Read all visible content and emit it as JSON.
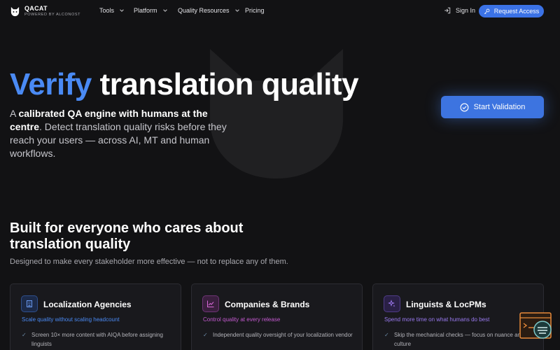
{
  "nav": {
    "logo_name": "QACAT",
    "logo_sub": "POWERED BY ALCONOST",
    "items": [
      {
        "label": "Tools"
      },
      {
        "label": "Platform"
      },
      {
        "label": "Quality Resources"
      },
      {
        "label": "Pricing"
      }
    ],
    "signin": "Sign In",
    "request_access": "Request Access"
  },
  "hero": {
    "title_accent": "Verify",
    "title_rest": "translation quality",
    "desc_prefix": "A ",
    "desc_bold": "calibrated QA engine with humans at the centre",
    "desc_suffix": ". Detect translation quality risks before they reach your users — across AI, MT and human workflows.",
    "start_button": "Start Validation"
  },
  "section": {
    "title": "Built for everyone who cares about translation quality",
    "subtitle": "Designed to make every stakeholder more effective — not to replace any of them."
  },
  "cards": [
    {
      "title": "Localization Agencies",
      "tag": "Scale quality without scaling headcount",
      "item": "Screen 10× more content with AIQA before assigning linguists",
      "icon": "building-icon",
      "accent": "#3b6fd6"
    },
    {
      "title": "Companies & Brands",
      "tag": "Control quality at every release",
      "item": "Independent quality oversight of your localization vendor",
      "icon": "chart-icon",
      "accent": "#c04ac8"
    },
    {
      "title": "Linguists & LocPMs",
      "tag": "Spend more time on what humans do best",
      "item": "Skip the mechanical checks — focus on nuance and culture",
      "icon": "sparkle-icon",
      "accent": "#8a5ae6"
    }
  ],
  "colors": {
    "background": "#121214",
    "accent_blue": "#4a8af4",
    "button_blue": "#3b72e6"
  }
}
